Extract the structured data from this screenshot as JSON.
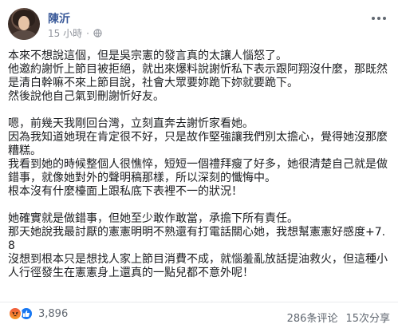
{
  "post": {
    "author_name": "陳沂",
    "timestamp": "15 小時",
    "privacy_icon": "globe-icon",
    "more_icon": "more-options-icon",
    "paragraphs": [
      "本來不想說這個，但是吳宗憲的發言真的太讓人惱怒了。\n他邀約謝忻上節目被拒絕，就出來爆料說謝忻私下表示跟阿翔沒什麼，那既然是清白幹嘛不來上節目說，社會大眾要妳跪下妳就要跪下。\n然後說他自己氣到刪謝忻好友。",
      "嗯，前幾天我剛回台灣，立刻直奔去謝忻家看她。\n因為我知道她現在肯定很不好，只是故作堅強讓我們別太擔心，覺得她沒那麼糟糕。\n我看到她的時候整個人很憔悴，短短一個禮拜瘦了好多，她很清楚自己就是做錯事，就像她對外的聲明稿那樣，所以深刻的懺悔中。\n根本沒有什麼檯面上跟私底下表裡不一的狀況！",
      "她確實就是做錯事，但她至少敢作敢當，承擔下所有責任。\n那天她說我最討厭的憲憲明明不熟還有打電話關心她，我想幫憲憲好感度+7.8\n沒想到根本只是想找人家上節目消費不成，就惱羞亂放話提油救火，但這種小人行徑發生在憲憲身上還真的一點兒都不意外呢！"
    ]
  },
  "footer": {
    "reaction_icons": [
      "angry-reaction-icon",
      "like-reaction-icon"
    ],
    "reaction_count": "3,896",
    "comments": "286条评论",
    "shares": "15次分享"
  }
}
